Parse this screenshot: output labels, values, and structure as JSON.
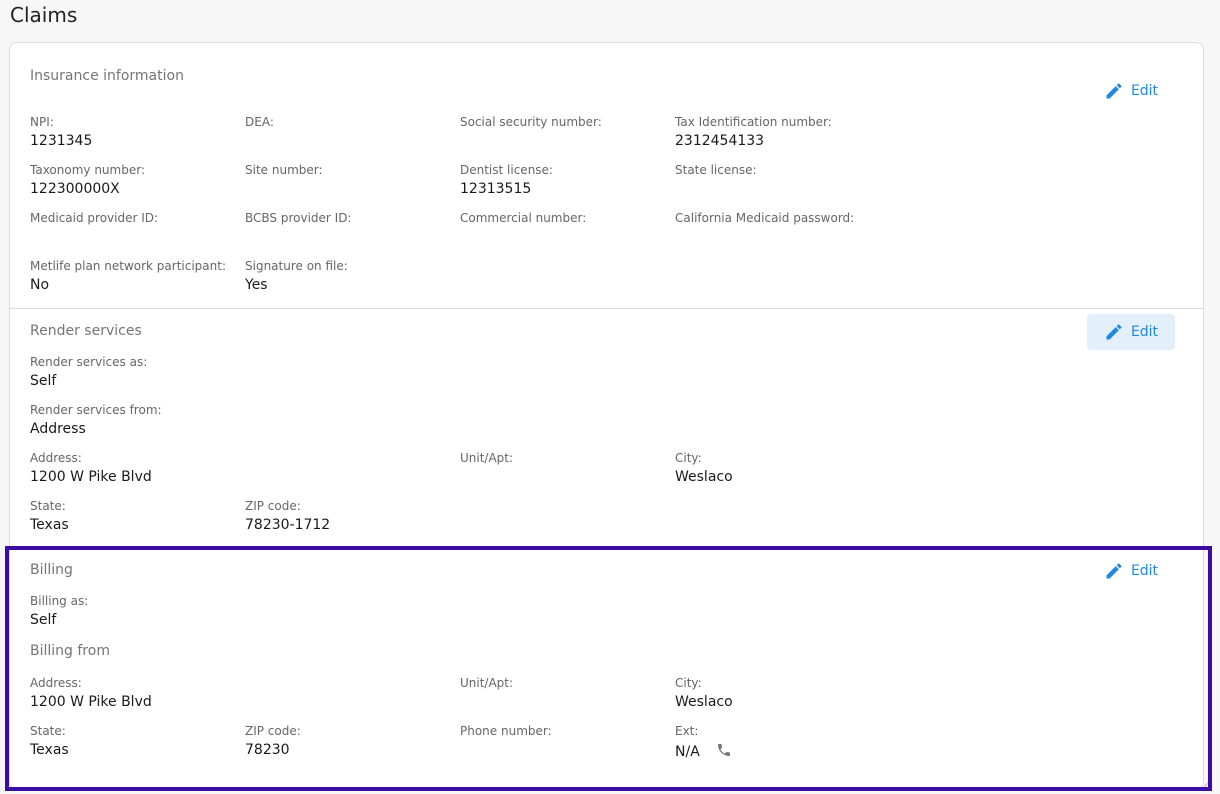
{
  "page": {
    "title": "Claims"
  },
  "insurance": {
    "title": "Insurance information",
    "edit_label": "Edit",
    "fields": {
      "npi": {
        "label": "NPI:",
        "value": "1231345"
      },
      "dea": {
        "label": "DEA:",
        "value": ""
      },
      "ssn": {
        "label": "Social security number:",
        "value": ""
      },
      "tin": {
        "label": "Tax Identification number:",
        "value": "2312454133"
      },
      "taxonomy": {
        "label": "Taxonomy number:",
        "value": "122300000X"
      },
      "site": {
        "label": "Site number:",
        "value": ""
      },
      "dentist_license": {
        "label": "Dentist license:",
        "value": "12313515"
      },
      "state_license": {
        "label": "State license:",
        "value": ""
      },
      "medicaid_id": {
        "label": "Medicaid provider ID:",
        "value": ""
      },
      "bcbs_id": {
        "label": "BCBS provider ID:",
        "value": ""
      },
      "commercial": {
        "label": "Commercial number:",
        "value": ""
      },
      "ca_medicaid_pw": {
        "label": "California Medicaid password:",
        "value": ""
      },
      "metlife": {
        "label": "Metlife plan network participant:",
        "value": "No"
      },
      "signature": {
        "label": "Signature on file:",
        "value": "Yes"
      }
    }
  },
  "render": {
    "title": "Render services",
    "edit_label": "Edit",
    "fields": {
      "as": {
        "label": "Render services as:",
        "value": "Self"
      },
      "from": {
        "label": "Render services from:",
        "value": "Address"
      },
      "address": {
        "label": "Address:",
        "value": "1200 W Pike Blvd"
      },
      "unit": {
        "label": "Unit/Apt:",
        "value": ""
      },
      "city": {
        "label": "City:",
        "value": "Weslaco"
      },
      "state": {
        "label": "State:",
        "value": "Texas"
      },
      "zip": {
        "label": "ZIP code:",
        "value": "78230-1712"
      }
    }
  },
  "billing": {
    "title": "Billing",
    "edit_label": "Edit",
    "from_title": "Billing from",
    "fields": {
      "as": {
        "label": "Billing as:",
        "value": "Self"
      },
      "address": {
        "label": "Address:",
        "value": "1200 W Pike Blvd"
      },
      "unit": {
        "label": "Unit/Apt:",
        "value": ""
      },
      "city": {
        "label": "City:",
        "value": "Weslaco"
      },
      "state": {
        "label": "State:",
        "value": "Texas"
      },
      "zip": {
        "label": "ZIP code:",
        "value": "78230"
      },
      "phone": {
        "label": "Phone number:",
        "value": ""
      },
      "ext": {
        "label": "Ext:",
        "value": "N/A"
      }
    }
  },
  "icons": {
    "edit": "pencil-icon",
    "phone": "phone-icon"
  },
  "colors": {
    "accent": "#1e88e5",
    "highlight": "#3a0ca3",
    "hover_bg": "#e3f0fc"
  }
}
